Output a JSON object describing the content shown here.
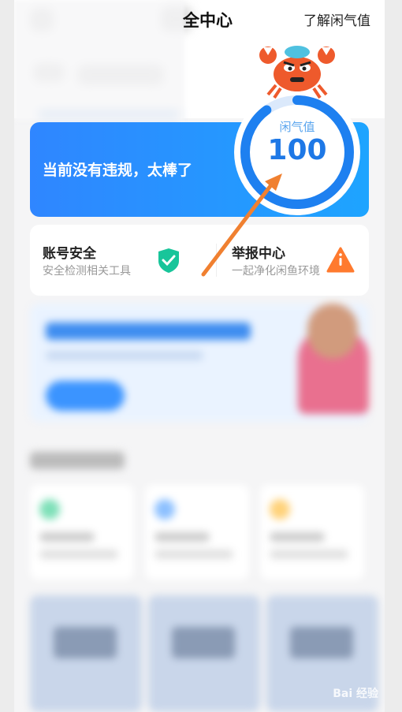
{
  "header": {
    "title": "全中心",
    "learn_link": "了解闲气值"
  },
  "status": {
    "message": "当前没有违规，太棒了",
    "gauge_label": "闲气值",
    "gauge_value": "100",
    "gauge_fill": 0.9
  },
  "tools": [
    {
      "title": "账号安全",
      "subtitle": "安全检测相关工具",
      "icon": "shield-check-icon",
      "color": "#18c59a"
    },
    {
      "title": "举报中心",
      "subtitle": "一起净化闲鱼环境",
      "icon": "warning-icon",
      "color": "#ff7a2e"
    }
  ],
  "watermark": "Bai 经验",
  "colors": {
    "accent": "#2f86ff",
    "gauge_ring": "#1e80f0",
    "arrow": "#f08030"
  }
}
